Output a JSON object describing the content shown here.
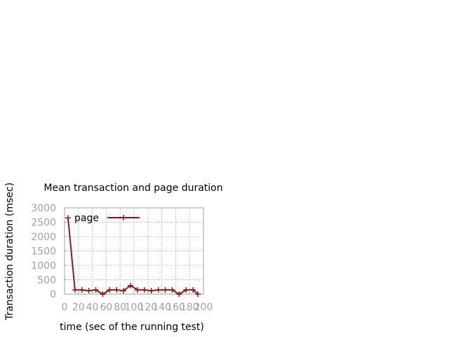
{
  "chart_data": {
    "type": "line",
    "title": "Mean transaction and page duration",
    "xlabel": "time (sec of the running test)",
    "ylabel": "Transaction duration (msec)",
    "xlim": [
      0,
      200
    ],
    "ylim": [
      0,
      3000
    ],
    "xticks": [
      0,
      20,
      40,
      60,
      80,
      100,
      120,
      140,
      160,
      180,
      200
    ],
    "yticks": [
      0,
      500,
      1000,
      1500,
      2000,
      2500,
      3000
    ],
    "grid": true,
    "legend_position": "top-left",
    "series": [
      {
        "name": "page",
        "color": "#8b1a1a",
        "x": [
          5,
          15,
          25,
          35,
          45,
          55,
          65,
          75,
          85,
          95,
          105,
          115,
          125,
          135,
          145,
          155,
          165,
          175,
          185,
          192
        ],
        "y": [
          2650,
          150,
          150,
          120,
          150,
          0,
          150,
          150,
          120,
          300,
          150,
          150,
          120,
          150,
          150,
          150,
          0,
          150,
          150,
          0
        ]
      }
    ]
  }
}
